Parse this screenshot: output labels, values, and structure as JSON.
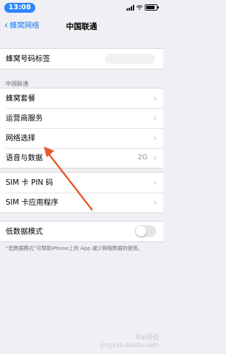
{
  "status_bar": {
    "time": "13:08",
    "battery_level": 0.85
  },
  "nav": {
    "back_label": "蜂窝网络",
    "title": "中国联通"
  },
  "number_label": {
    "label": "蜂窝号码标签"
  },
  "carrier_section": {
    "header": "中国联通",
    "items": [
      {
        "label": "蜂窝套餐"
      },
      {
        "label": "运营商服务"
      },
      {
        "label": "网络选择"
      },
      {
        "label": "语音与数据",
        "detail": "2G"
      }
    ]
  },
  "sim_section": {
    "items": [
      {
        "label": "SIM 卡 PIN 码"
      },
      {
        "label": "SIM 卡应用程序"
      }
    ]
  },
  "low_data": {
    "label": "低数据模式",
    "enabled": false,
    "footer": "“低数据模式”可帮助iPhone上的 App 减少网络数据的使用。"
  },
  "watermark": {
    "line1": "Bai经验",
    "line2": "jingyan.baidu.com"
  },
  "colors": {
    "accent": "#1c7cf4",
    "arrow": "#e8582e",
    "background": "#efeff4"
  },
  "icons": [
    "chevron-left-icon",
    "chevron-right-icon",
    "signal-icon",
    "wifi-icon",
    "battery-icon"
  ]
}
